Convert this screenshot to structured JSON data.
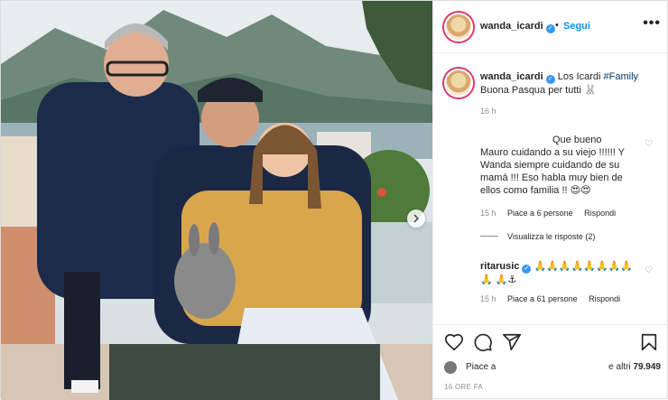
{
  "header": {
    "username": "wanda_icardi",
    "separator": "•",
    "follow_label": "Segui",
    "more_glyph": "•••"
  },
  "caption": {
    "username": "wanda_icardi",
    "text": "Los Icardi",
    "hashtag": "#Family",
    "line2": "Buona Pasqua per tutti 🐰",
    "time": "16 h"
  },
  "comments": [
    {
      "username": "Que bueno",
      "text": "Mauro cuidando a su viejo !!!!!! Y Wanda siempre cuidando de su mamá !!! Eso habla muy bien de ellos como familia !! 😍😍",
      "time": "15 h",
      "likes": "Piace a 6 persone",
      "reply": "Rispondi"
    },
    {
      "username": "ritarusic",
      "text": "🙏🙏🙏🙏🙏🙏🙏🙏🙏 🙏⚓",
      "time": "15 h",
      "likes": "Piace a 61 persone",
      "reply": "Rispondi"
    }
  ],
  "view_replies": "Visualizza le risposte (2)",
  "likes": {
    "piace": "Piace a",
    "altri_prefix": "e altri",
    "count": "79.949"
  },
  "post_date": "16 ORE FA",
  "icons": {
    "heart": "heart-icon",
    "comment": "comment-icon",
    "share": "share-icon",
    "bookmark": "bookmark-icon",
    "next": "chevron-right-icon"
  },
  "colors": {
    "accent": "#0095f6",
    "verified": "#3897f0",
    "muted": "#8e8e8e"
  }
}
